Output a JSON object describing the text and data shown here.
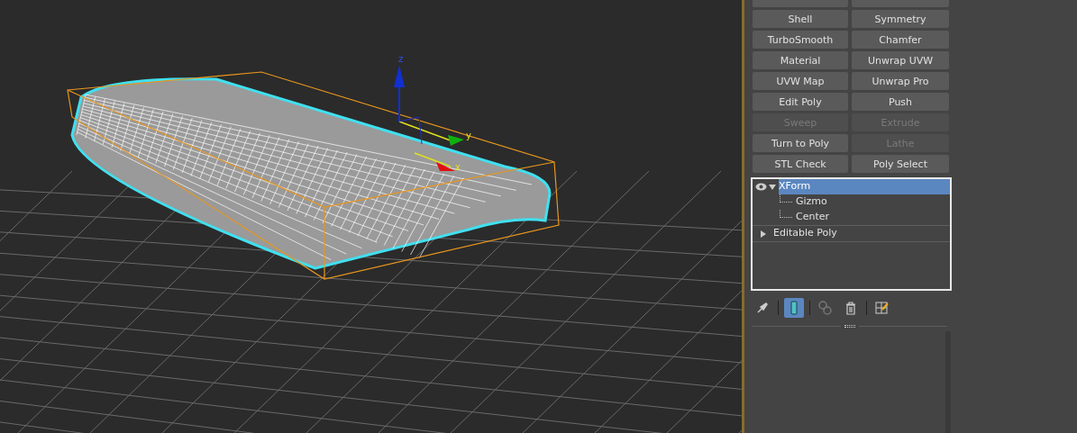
{
  "viewport": {
    "gizmo_axes": [
      "z",
      "y",
      "x"
    ]
  },
  "modifier_buttons": [
    {
      "label": "Shell",
      "disabled": false
    },
    {
      "label": "Symmetry",
      "disabled": false
    },
    {
      "label": "TurboSmooth",
      "disabled": false
    },
    {
      "label": "Chamfer",
      "disabled": false
    },
    {
      "label": "Material",
      "disabled": false
    },
    {
      "label": "Unwrap UVW",
      "disabled": false
    },
    {
      "label": "UVW Map",
      "disabled": false
    },
    {
      "label": "Unwrap Pro",
      "disabled": false
    },
    {
      "label": "Edit Poly",
      "disabled": false
    },
    {
      "label": "Push",
      "disabled": false
    },
    {
      "label": "Sweep",
      "disabled": true
    },
    {
      "label": "Extrude",
      "disabled": true
    },
    {
      "label": "Turn to Poly",
      "disabled": false
    },
    {
      "label": "Lathe",
      "disabled": true
    },
    {
      "label": "STL Check",
      "disabled": false
    },
    {
      "label": "Poly Select",
      "disabled": false
    }
  ],
  "modifier_stack": [
    {
      "label": "XForm",
      "selected": true,
      "expanded": true,
      "visible": true,
      "children": [
        {
          "label": "Gizmo",
          "selected": false
        },
        {
          "label": "Center",
          "selected": false
        }
      ]
    },
    {
      "label": "Editable Poly",
      "selected": false,
      "expanded": false,
      "visible": false
    }
  ],
  "stack_toolbar": [
    {
      "kind": "pin",
      "selected": false
    },
    {
      "kind": "show-end-result",
      "selected": true
    },
    {
      "kind": "make-unique",
      "selected": false
    },
    {
      "kind": "remove",
      "selected": false
    },
    {
      "kind": "configure",
      "selected": false
    }
  ]
}
